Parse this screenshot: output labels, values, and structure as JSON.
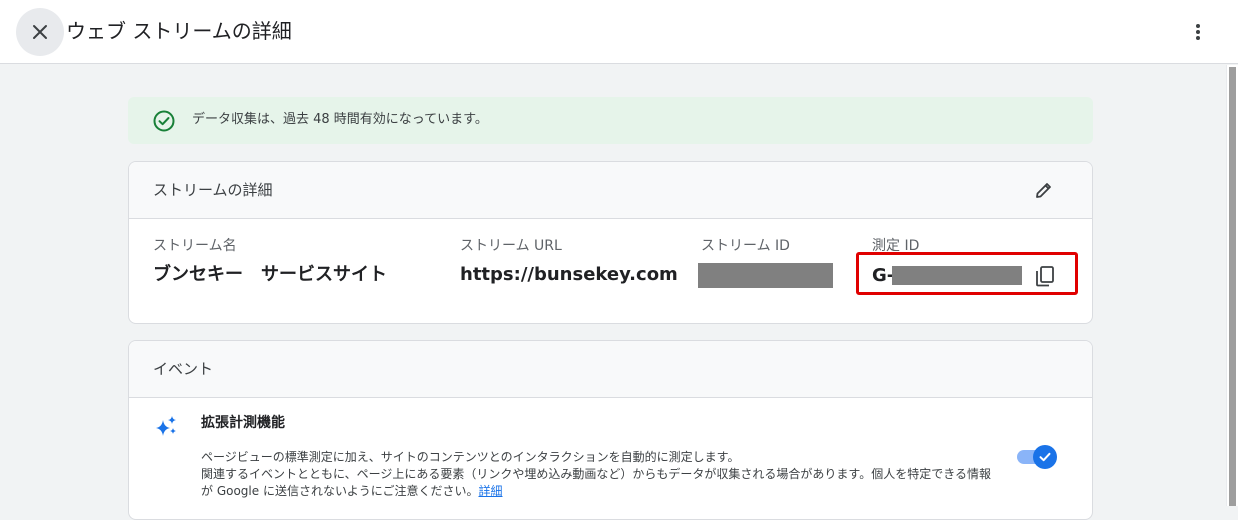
{
  "header": {
    "title": "ウェブ ストリームの詳細"
  },
  "banner": {
    "text": "データ収集は、過去 48 時間有効になっています。",
    "status_color": "#188038"
  },
  "stream_details": {
    "title": "ストリームの詳細",
    "fields": {
      "name": {
        "label": "ストリーム名",
        "value": "ブンセキー　サービスサイト"
      },
      "url": {
        "label": "ストリーム URL",
        "value": "https://bunsekey.com"
      },
      "id": {
        "label": "ストリーム ID",
        "value": ""
      },
      "measurement_id": {
        "label": "測定 ID",
        "prefix": "G-"
      }
    },
    "highlight_color": "#e00000"
  },
  "events": {
    "title": "イベント",
    "enhanced": {
      "title": "拡張計測機能",
      "description_line1": "ページビューの標準測定に加え、サイトのコンテンツとのインタラクションを自動的に測定します。",
      "description_line2": "関連するイベントとともに、ページ上にある要素（リンクや埋め込み動画など）からもデータが収集される場合があります。個人を特定できる情報",
      "description_line3": "が Google に送信されないようにご注意ください。",
      "link": "詳細",
      "enabled": true
    }
  },
  "colors": {
    "accent": "#1a73e8",
    "banner_bg": "#e6f4ea",
    "page_bg": "#f1f3f4"
  }
}
